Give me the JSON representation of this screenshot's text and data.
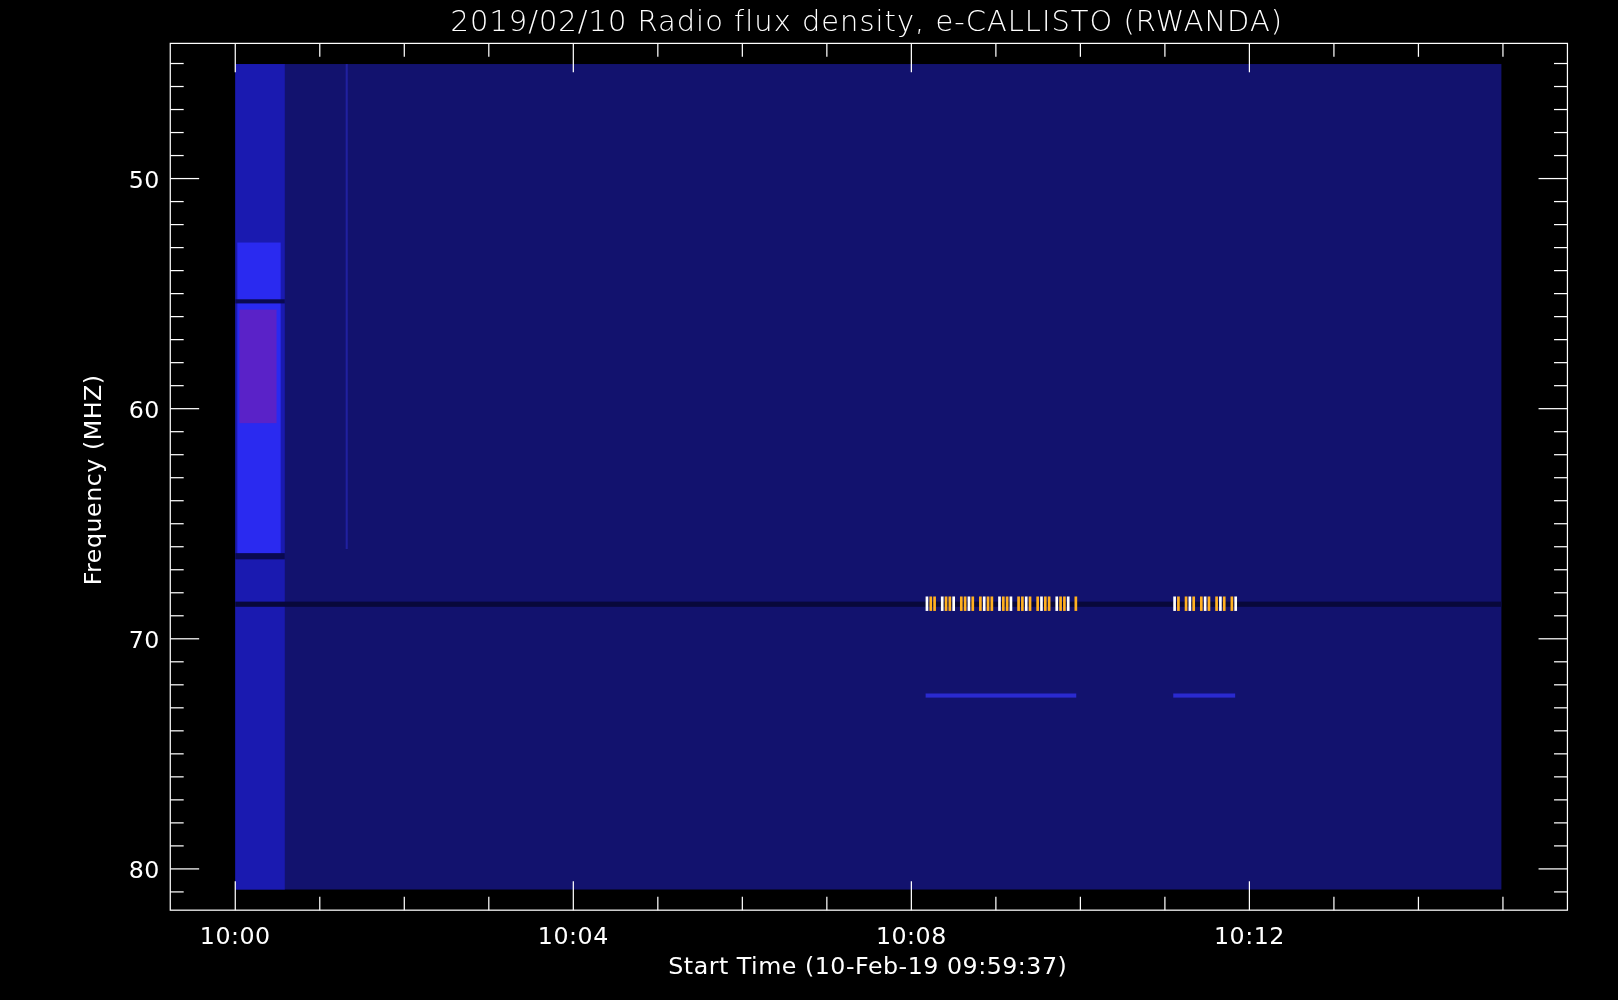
{
  "title": "2019/02/10  Radio flux density, e-CALLISTO (RWANDA)",
  "y_axis": {
    "label": "Frequency (MHZ)",
    "tick_labels": [
      "50",
      "60",
      "70",
      "80"
    ]
  },
  "x_axis": {
    "label": "Start Time (10-Feb-19 09:59:37)",
    "tick_labels": [
      "10:00",
      "10:04",
      "10:08",
      "10:12"
    ]
  }
}
